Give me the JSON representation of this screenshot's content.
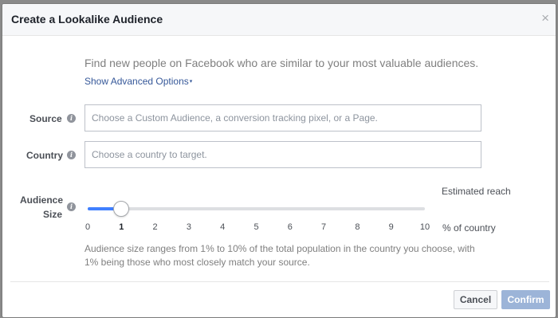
{
  "dialog": {
    "title": "Create a Lookalike Audience",
    "close_glyph": "×"
  },
  "intro": {
    "text": "Find new people on Facebook who are similar to your most valuable audiences.",
    "advanced_label": "Show Advanced Options",
    "advanced_caret": "▾"
  },
  "source": {
    "label": "Source",
    "info_glyph": "i",
    "placeholder": "Choose a Custom Audience, a conversion tracking pixel, or a Page.",
    "value": ""
  },
  "country": {
    "label": "Country",
    "info_glyph": "i",
    "placeholder": "Choose a country to target.",
    "value": ""
  },
  "audience_size": {
    "label_line1": "Audience",
    "label_line2": "Size",
    "info_glyph": "i",
    "estimated_reach_label": "Estimated reach",
    "slider_value": 1,
    "slider_min": 0,
    "slider_max": 10,
    "ticks": [
      "0",
      "1",
      "2",
      "3",
      "4",
      "5",
      "6",
      "7",
      "8",
      "9",
      "10"
    ],
    "unit_label": "% of country",
    "help_text": "Audience size ranges from 1% to 10% of the total population in the country you choose, with 1% being those who most closely match your source."
  },
  "footer": {
    "cancel_label": "Cancel",
    "confirm_label": "Confirm"
  },
  "colors": {
    "accent": "#4080ff",
    "link": "#365899",
    "confirm_disabled": "#9cb4d8"
  }
}
